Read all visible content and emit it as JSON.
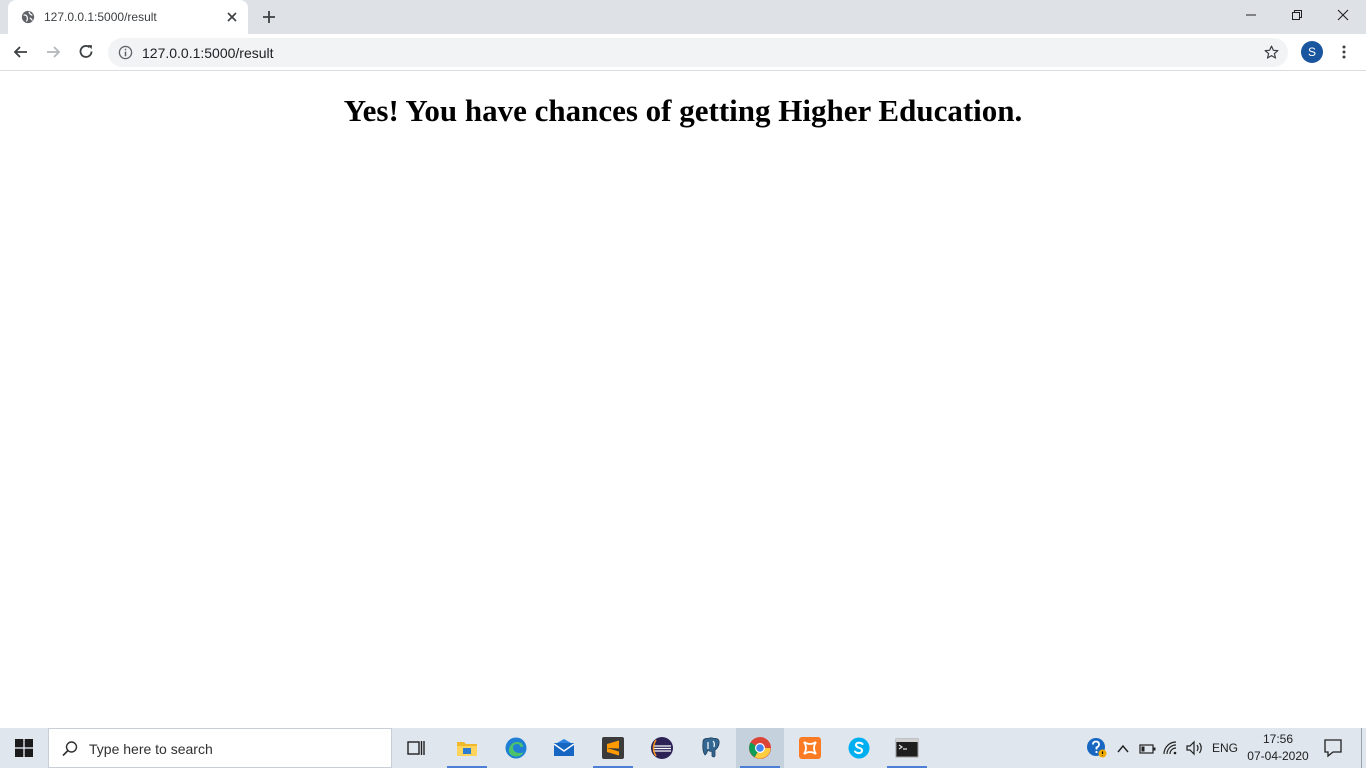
{
  "browser": {
    "tab": {
      "title": "127.0.0.1:5000/result",
      "favicon": "globe-icon"
    },
    "address": {
      "url": "127.0.0.1:5000/result"
    },
    "profile_initial": "S",
    "accent": "#1a56a0"
  },
  "page": {
    "heading": "Yes! You have chances of getting Higher Education."
  },
  "taskbar": {
    "search_placeholder": "Type here to search",
    "apps": [
      "task-view-icon",
      "file-explorer-icon",
      "edge-icon",
      "mail-icon",
      "sublime-text-icon",
      "eclipse-icon",
      "postgresql-icon",
      "chrome-icon",
      "xampp-icon",
      "skype-icon",
      "command-prompt-icon"
    ],
    "tray": {
      "language": "ENG",
      "time": "17:56",
      "date": "07-04-2020"
    }
  }
}
